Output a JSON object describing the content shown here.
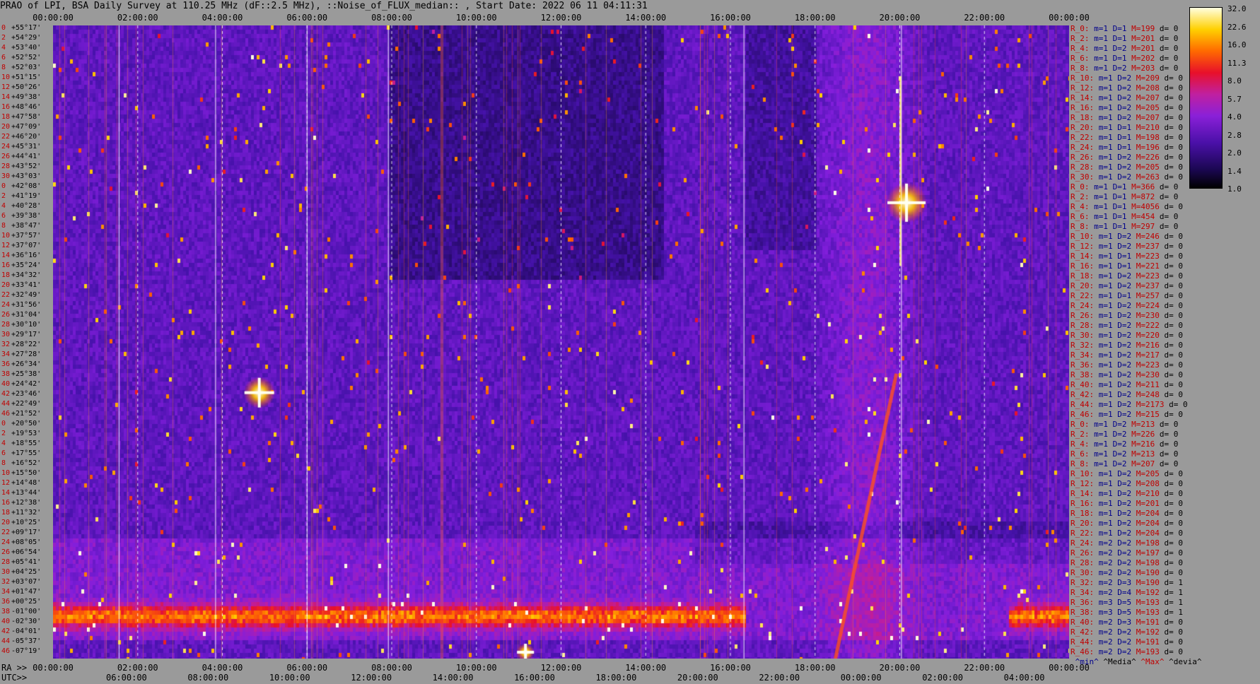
{
  "title": "PRAO of LPI, BSA Daily Survey at 110.25 MHz (dF::2.5 MHz), ::Noise_of_FLUX_median:: , Start Date: 2022 06 11 04:11:31",
  "top_ticks": [
    "00:00:00",
    "02:00:00",
    "04:00:00",
    "06:00:00",
    "08:00:00",
    "10:00:00",
    "12:00:00",
    "14:00:00",
    "16:00:00",
    "18:00:00",
    "20:00:00",
    "22:00:00",
    "00:00:00"
  ],
  "bottom_ra_label": "RA >>",
  "bottom_ra_ticks": [
    "00:00:00",
    "02:00:00",
    "04:00:00",
    "06:00:00",
    "08:00:00",
    "10:00:00",
    "12:00:00",
    "14:00:00",
    "16:00:00",
    "18:00:00",
    "20:00:00",
    "22:00:00",
    "00:00:00"
  ],
  "bottom_utc_label": "UTC>>",
  "bottom_utc_ticks": [
    "06:00:00",
    "08:00:00",
    "10:00:00",
    "12:00:00",
    "14:00:00",
    "16:00:00",
    "18:00:00",
    "20:00:00",
    "22:00:00",
    "00:00:00",
    "02:00:00",
    "04:00:00"
  ],
  "dec_rows": [
    [
      "0",
      "+55°17'"
    ],
    [
      "2",
      "+54°29'"
    ],
    [
      "4",
      "+53°40'"
    ],
    [
      "6",
      "+52°52'"
    ],
    [
      "8",
      "+52°03'"
    ],
    [
      "10",
      "+51°15'"
    ],
    [
      "12",
      "+50°26'"
    ],
    [
      "14",
      "+49°38'"
    ],
    [
      "16",
      "+48°46'"
    ],
    [
      "18",
      "+47°58'"
    ],
    [
      "20",
      "+47°09'"
    ],
    [
      "22",
      "+46°20'"
    ],
    [
      "24",
      "+45°31'"
    ],
    [
      "26",
      "+44°41'"
    ],
    [
      "28",
      "+43°52'"
    ],
    [
      "30",
      "+43°03'"
    ],
    [
      "0",
      "+42°08'"
    ],
    [
      "2",
      "+41°19'"
    ],
    [
      "4",
      "+40°28'"
    ],
    [
      "6",
      "+39°38'"
    ],
    [
      "8",
      "+38°47'"
    ],
    [
      "10",
      "+37°57'"
    ],
    [
      "12",
      "+37°07'"
    ],
    [
      "14",
      "+36°16'"
    ],
    [
      "16",
      "+35°24'"
    ],
    [
      "18",
      "+34°32'"
    ],
    [
      "20",
      "+33°41'"
    ],
    [
      "22",
      "+32°49'"
    ],
    [
      "24",
      "+31°56'"
    ],
    [
      "26",
      "+31°04'"
    ],
    [
      "28",
      "+30°10'"
    ],
    [
      "30",
      "+29°17'"
    ],
    [
      "32",
      "+28°22'"
    ],
    [
      "34",
      "+27°28'"
    ],
    [
      "36",
      "+26°34'"
    ],
    [
      "38",
      "+25°38'"
    ],
    [
      "40",
      "+24°42'"
    ],
    [
      "42",
      "+23°46'"
    ],
    [
      "44",
      "+22°49'"
    ],
    [
      "46",
      "+21°52'"
    ],
    [
      "0",
      "+20°50'"
    ],
    [
      "2",
      "+19°53'"
    ],
    [
      "4",
      "+18°55'"
    ],
    [
      "6",
      "+17°55'"
    ],
    [
      "8",
      "+16°52'"
    ],
    [
      "10",
      "+15°50'"
    ],
    [
      "12",
      "+14°48'"
    ],
    [
      "14",
      "+13°44'"
    ],
    [
      "16",
      "+12°38'"
    ],
    [
      "18",
      "+11°32'"
    ],
    [
      "20",
      "+10°25'"
    ],
    [
      "22",
      "+09°17'"
    ],
    [
      "24",
      "+08°05'"
    ],
    [
      "26",
      "+06°54'"
    ],
    [
      "28",
      "+05°41'"
    ],
    [
      "30",
      "+04°25'"
    ],
    [
      "32",
      "+03°07'"
    ],
    [
      "34",
      "+01°47'"
    ],
    [
      "36",
      "+00°25'"
    ],
    [
      "38",
      "-01°00'"
    ],
    [
      "40",
      "-02°30'"
    ],
    [
      "42",
      "-04°01'"
    ],
    [
      "44",
      "-05°37'"
    ],
    [
      "46",
      "-07°19'"
    ]
  ],
  "stats": [
    [
      "R_0:",
      "m=1",
      "D=1",
      "M=199",
      "d= 0"
    ],
    [
      "R_2:",
      "m=1",
      "D=1",
      "M=201",
      "d= 0"
    ],
    [
      "R_4:",
      "m=1",
      "D=2",
      "M=201",
      "d= 0"
    ],
    [
      "R_6:",
      "m=1",
      "D=1",
      "M=202",
      "d= 0"
    ],
    [
      "R_8:",
      "m=1",
      "D=2",
      "M=203",
      "d= 0"
    ],
    [
      "R_10:",
      "m=1",
      "D=2",
      "M=209",
      "d= 0"
    ],
    [
      "R_12:",
      "m=1",
      "D=2",
      "M=208",
      "d= 0"
    ],
    [
      "R_14:",
      "m=1",
      "D=2",
      "M=207",
      "d= 0"
    ],
    [
      "R_16:",
      "m=1",
      "D=2",
      "M=205",
      "d= 0"
    ],
    [
      "R_18:",
      "m=1",
      "D=2",
      "M=207",
      "d= 0"
    ],
    [
      "R_20:",
      "m=1",
      "D=1",
      "M=210",
      "d= 0"
    ],
    [
      "R_22:",
      "m=1",
      "D=1",
      "M=198",
      "d= 0"
    ],
    [
      "R_24:",
      "m=1",
      "D=1",
      "M=196",
      "d= 0"
    ],
    [
      "R_26:",
      "m=1",
      "D=2",
      "M=226",
      "d= 0"
    ],
    [
      "R_28:",
      "m=1",
      "D=2",
      "M=205",
      "d= 0"
    ],
    [
      "R_30:",
      "m=1",
      "D=2",
      "M=263",
      "d= 0"
    ],
    [
      "R_0:",
      "m=1",
      "D=1",
      "M=366",
      "d= 0"
    ],
    [
      "R_2:",
      "m=1",
      "D=1",
      "M=872",
      "d= 0"
    ],
    [
      "R_4:",
      "m=1",
      "D=1",
      "M=4056",
      "d= 0"
    ],
    [
      "R_6:",
      "m=1",
      "D=1",
      "M=454",
      "d= 0"
    ],
    [
      "R_8:",
      "m=1",
      "D=1",
      "M=297",
      "d= 0"
    ],
    [
      "R_10:",
      "m=1",
      "D=2",
      "M=246",
      "d= 0"
    ],
    [
      "R_12:",
      "m=1",
      "D=2",
      "M=237",
      "d= 0"
    ],
    [
      "R_14:",
      "m=1",
      "D=1",
      "M=223",
      "d= 0"
    ],
    [
      "R_16:",
      "m=1",
      "D=1",
      "M=221",
      "d= 0"
    ],
    [
      "R_18:",
      "m=1",
      "D=2",
      "M=223",
      "d= 0"
    ],
    [
      "R_20:",
      "m=1",
      "D=2",
      "M=237",
      "d= 0"
    ],
    [
      "R_22:",
      "m=1",
      "D=1",
      "M=257",
      "d= 0"
    ],
    [
      "R_24:",
      "m=1",
      "D=2",
      "M=224",
      "d= 0"
    ],
    [
      "R_26:",
      "m=1",
      "D=2",
      "M=230",
      "d= 0"
    ],
    [
      "R_28:",
      "m=1",
      "D=2",
      "M=222",
      "d= 0"
    ],
    [
      "R_30:",
      "m=1",
      "D=2",
      "M=220",
      "d= 0"
    ],
    [
      "R_32:",
      "m=1",
      "D=2",
      "M=216",
      "d= 0"
    ],
    [
      "R_34:",
      "m=1",
      "D=2",
      "M=217",
      "d= 0"
    ],
    [
      "R_36:",
      "m=1",
      "D=2",
      "M=223",
      "d= 0"
    ],
    [
      "R_38:",
      "m=1",
      "D=2",
      "M=230",
      "d= 0"
    ],
    [
      "R_40:",
      "m=1",
      "D=2",
      "M=211",
      "d= 0"
    ],
    [
      "R_42:",
      "m=1",
      "D=2",
      "M=248",
      "d= 0"
    ],
    [
      "R_44:",
      "m=1",
      "D=2",
      "M=2173",
      "d= 0"
    ],
    [
      "R_46:",
      "m=1",
      "D=2",
      "M=215",
      "d= 0"
    ],
    [
      "R_0:",
      "m=1",
      "D=2",
      "M=213",
      "d= 0"
    ],
    [
      "R_2:",
      "m=1",
      "D=2",
      "M=226",
      "d= 0"
    ],
    [
      "R_4:",
      "m=1",
      "D=2",
      "M=216",
      "d= 0"
    ],
    [
      "R_6:",
      "m=1",
      "D=2",
      "M=213",
      "d= 0"
    ],
    [
      "R_8:",
      "m=1",
      "D=2",
      "M=207",
      "d= 0"
    ],
    [
      "R_10:",
      "m=1",
      "D=2",
      "M=205",
      "d= 0"
    ],
    [
      "R_12:",
      "m=1",
      "D=2",
      "M=208",
      "d= 0"
    ],
    [
      "R_14:",
      "m=1",
      "D=2",
      "M=210",
      "d= 0"
    ],
    [
      "R_16:",
      "m=1",
      "D=2",
      "M=201",
      "d= 0"
    ],
    [
      "R_18:",
      "m=1",
      "D=2",
      "M=204",
      "d= 0"
    ],
    [
      "R_20:",
      "m=1",
      "D=2",
      "M=204",
      "d= 0"
    ],
    [
      "R_22:",
      "m=1",
      "D=2",
      "M=204",
      "d= 0"
    ],
    [
      "R_24:",
      "m=2",
      "D=2",
      "M=198",
      "d= 0"
    ],
    [
      "R_26:",
      "m=2",
      "D=2",
      "M=197",
      "d= 0"
    ],
    [
      "R_28:",
      "m=2",
      "D=2",
      "M=198",
      "d= 0"
    ],
    [
      "R_30:",
      "m=2",
      "D=2",
      "M=190",
      "d= 0"
    ],
    [
      "R_32:",
      "m=2",
      "D=3",
      "M=190",
      "d= 1"
    ],
    [
      "R_34:",
      "m=2",
      "D=4",
      "M=192",
      "d= 1"
    ],
    [
      "R_36:",
      "m=3",
      "D=5",
      "M=193",
      "d= 1"
    ],
    [
      "R_38:",
      "m=3",
      "D=5",
      "M=193",
      "d= 1"
    ],
    [
      "R_40:",
      "m=2",
      "D=3",
      "M=191",
      "d= 0"
    ],
    [
      "R_42:",
      "m=2",
      "D=2",
      "M=192",
      "d= 0"
    ],
    [
      "R_44:",
      "m=2",
      "D=2",
      "M=191",
      "d= 0"
    ],
    [
      "R_46:",
      "m=2",
      "D=2",
      "M=193",
      "d= 0"
    ]
  ],
  "legend_words": [
    "^min^",
    "^Media^",
    "^Max^",
    "^devia^"
  ],
  "colorbar_ticks": [
    "32.0",
    "22.6",
    "16.0",
    "11.3",
    "8.0",
    "5.7",
    "4.0",
    "2.8",
    "2.0",
    "1.4",
    "1.0"
  ],
  "chart_data": {
    "type": "heatmap",
    "title": "PRAO of LPI, BSA Daily Survey at 110.25 MHz (dF::2.5 MHz), ::Noise_of_FLUX_median:: , Start Date: 2022 06 11 04:11:31",
    "x_ticks_ra": [
      "00:00:00",
      "02:00:00",
      "04:00:00",
      "06:00:00",
      "08:00:00",
      "10:00:00",
      "12:00:00",
      "14:00:00",
      "16:00:00",
      "18:00:00",
      "20:00:00",
      "22:00:00",
      "00:00:00"
    ],
    "y_ticks_dec": [
      "+55°17'",
      "-07°19'"
    ],
    "colorbar": {
      "min": 1.0,
      "max": 32.0,
      "scale": "log"
    },
    "features": [
      {
        "ra": "05:20",
        "dec": "+23°46'",
        "value": 32.0
      },
      {
        "ra": "19:55",
        "dec": "+40°28'",
        "value": 32.0
      },
      {
        "ra": "11:30",
        "dec": "-07°19'",
        "value": 32.0
      }
    ]
  }
}
